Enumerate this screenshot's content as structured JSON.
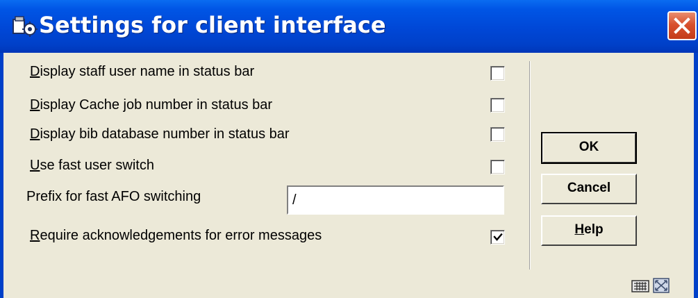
{
  "window": {
    "title": "Settings for client interface",
    "icon": "app-icon",
    "close_icon": "close-icon"
  },
  "settings": [
    {
      "label": "Display staff user name in status bar",
      "mnemonic": "D",
      "rest": "isplay staff user name in status bar",
      "checked": false
    },
    {
      "label": "Display Cache job number in status bar",
      "mnemonic": "D",
      "rest": "isplay Cache job number in status bar",
      "checked": false
    },
    {
      "label": "Display bib database number in status bar",
      "mnemonic": "D",
      "rest": "isplay bib database number in status bar",
      "checked": false
    },
    {
      "label": "Use fast user switch",
      "mnemonic": "U",
      "rest": "se fast user switch",
      "checked": false
    }
  ],
  "prefix": {
    "label": "Prefix for fast AFO switching",
    "value": "/"
  },
  "acknowledge": {
    "label": "Require acknowledgements for error messages",
    "mnemonic": "R",
    "rest": "equire acknowledgements for error messages",
    "checked": true
  },
  "buttons": {
    "ok": "OK",
    "cancel": "Cancel",
    "help_mnemonic": "H",
    "help_rest": "elp"
  },
  "status_icons": [
    "keyboard-icon",
    "resize-icon"
  ],
  "colors": {
    "titlebar": "#0047d6",
    "dialog_bg": "#ece9d8",
    "close_button": "#d8512e"
  }
}
